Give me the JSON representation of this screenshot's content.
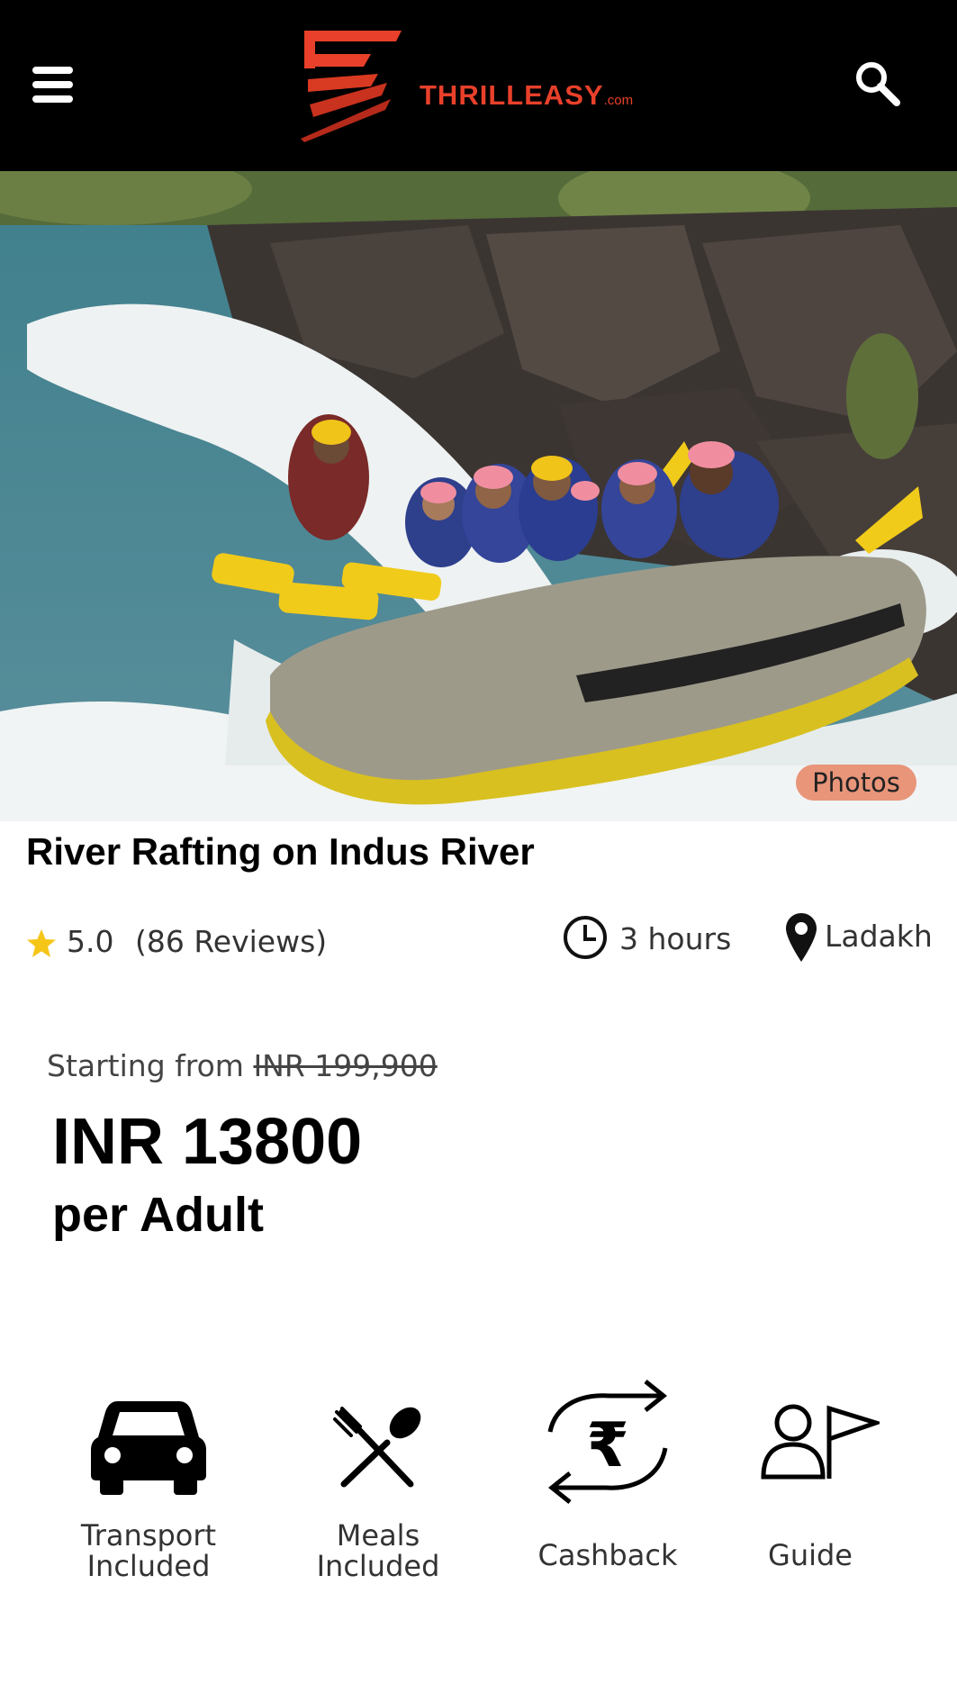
{
  "header": {
    "logo_text": "THRILLEASY",
    "logo_suffix": ".com",
    "brand_color": "#e8402a"
  },
  "hero": {
    "photos_label": "Photos",
    "photos_button_color": "#e8957a"
  },
  "activity": {
    "title": "River Rafting on Indus River",
    "rating": "5.0",
    "reviews": "(86 Reviews)",
    "duration": "3 hours",
    "location": "Ladakh"
  },
  "pricing": {
    "starting_prefix": "Starting from",
    "original_price": "INR 199,900",
    "price": "INR 13800",
    "unit": "per Adult"
  },
  "features": [
    {
      "icon": "car-icon",
      "label_line1": "Transport",
      "label_line2": "Included"
    },
    {
      "icon": "fork-spoon-icon",
      "label_line1": "Meals",
      "label_line2": "Included"
    },
    {
      "icon": "rupee-exchange-icon",
      "label_line1": "Cashback",
      "label_line2": ""
    },
    {
      "icon": "guide-flag-icon",
      "label_line1": "Guide",
      "label_line2": ""
    }
  ]
}
